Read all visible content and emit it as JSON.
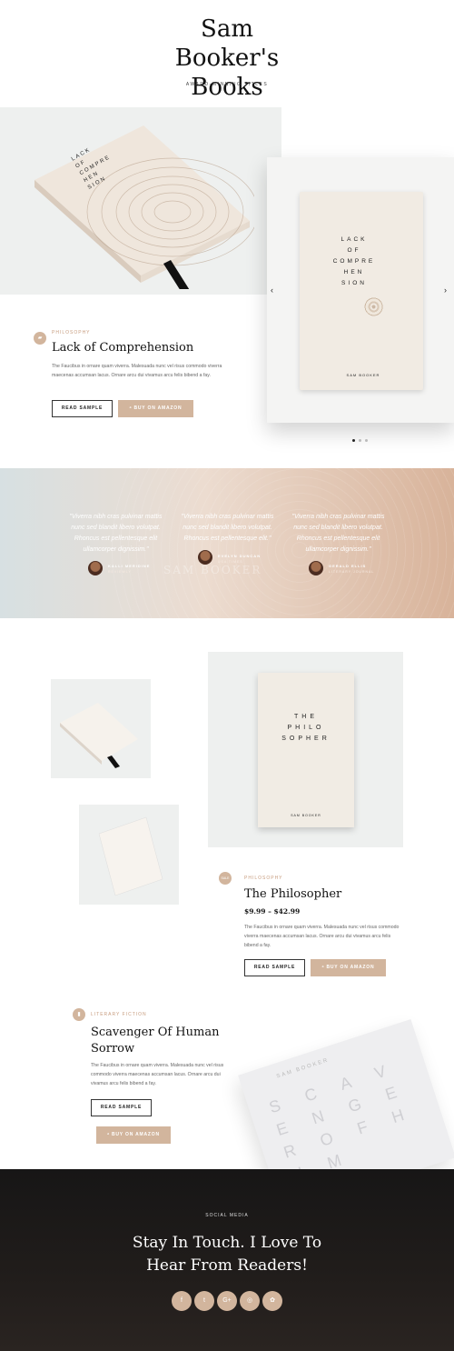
{
  "header": {
    "title": "Sam Booker's Books",
    "tagline": "AWARD-WINNING TITLES"
  },
  "hero": {
    "cover_title_lines": [
      "LACK",
      "OF",
      "COMPRE",
      "HEN",
      "SION"
    ],
    "cover_author": "SAM BOOKER",
    "category": "PHILOSOPHY",
    "title": "Lack of Comprehension",
    "description": "The Faucibus in ornare quam viverra. Malesuada nunc vel risus commodo viverra maecenas accumsan lacus. Ornare arcu dui vivamus arcu felis bibend a fay.",
    "read_sample": "READ SAMPLE",
    "buy": "BUY ON AMAZON",
    "prev_arrow": "‹",
    "next_arrow": "›"
  },
  "testimonials": {
    "watermark": "SAM BOOKER",
    "items": [
      {
        "quote": "\"Viverra nibh cras pulvinar mattis nunc sed blandit libero volutpat. Rhoncus est pellentesque elit ullamcorper dignissim.\"",
        "name": "KALLI MERIDINE",
        "org": "REVIEWLY"
      },
      {
        "quote": "\"Viverra nibh cras pulvinar mattis nunc sed blandit libero volutpat. Rhoncus est pellentesque elit.\"",
        "name": "EVELYN DUNCAN",
        "org": "USA TIMES"
      },
      {
        "quote": "\"Viverra nibh cras pulvinar mattis nunc sed blandit libero volutpat. Rhoncus est pellentesque elit ullamcorper dignissim.\"",
        "name": "GERALD ELLIS",
        "org": "LITERARY JOURNAL"
      }
    ]
  },
  "philosopher": {
    "cover_title_lines": [
      "THE",
      "PHILO",
      "SOPHER"
    ],
    "cover_author": "SAM BOOKER",
    "badge": "SALE",
    "category": "PHILOSOPHY",
    "title": "The Philosopher",
    "price": "$9.99 – $42.99",
    "description": "The Faucibus in ornare quam viverra. Malesuada nunc vel risus commodo viverra maecenas accumsan lacus. Ornare arcu dui vivamus arcu felis bibend a fay.",
    "read_sample": "READ SAMPLE",
    "buy": "BUY ON AMAZON"
  },
  "scavenger": {
    "category": "LITERARY FICTION",
    "title_line1": "Scavenger Of Human",
    "title_line2": "Sorrow",
    "description": "The Faucibus in ornare quam viverra. Malesuada nunc vel risus commodo viverra maecenas accumsan lacus. Ornare arcu dui vivamus arcu felis bibend a fay.",
    "read_sample": "READ SAMPLE",
    "buy": "BUY ON AMAZON",
    "cover_author": "SAM BOOKER",
    "cover_letters": "S C A V E N G E R O F H U M"
  },
  "footer": {
    "label": "SOCIAL MEDIA",
    "title_line1": "Stay In Touch. I Love To",
    "title_line2": "Hear From Readers!",
    "social": [
      "f",
      "t",
      "G+",
      "◎",
      "✿"
    ]
  }
}
